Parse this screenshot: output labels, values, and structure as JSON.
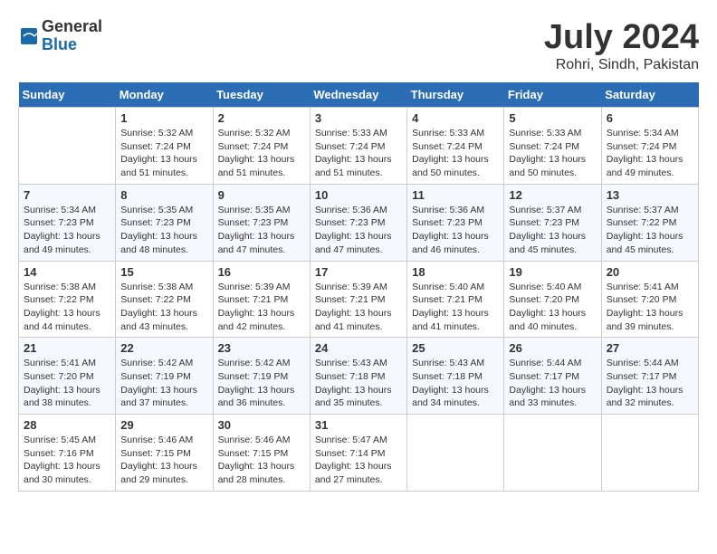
{
  "header": {
    "logo_general": "General",
    "logo_blue": "Blue",
    "month": "July 2024",
    "location": "Rohri, Sindh, Pakistan"
  },
  "weekdays": [
    "Sunday",
    "Monday",
    "Tuesday",
    "Wednesday",
    "Thursday",
    "Friday",
    "Saturday"
  ],
  "weeks": [
    [
      {
        "day": "",
        "info": ""
      },
      {
        "day": "1",
        "info": "Sunrise: 5:32 AM\nSunset: 7:24 PM\nDaylight: 13 hours\nand 51 minutes."
      },
      {
        "day": "2",
        "info": "Sunrise: 5:32 AM\nSunset: 7:24 PM\nDaylight: 13 hours\nand 51 minutes."
      },
      {
        "day": "3",
        "info": "Sunrise: 5:33 AM\nSunset: 7:24 PM\nDaylight: 13 hours\nand 51 minutes."
      },
      {
        "day": "4",
        "info": "Sunrise: 5:33 AM\nSunset: 7:24 PM\nDaylight: 13 hours\nand 50 minutes."
      },
      {
        "day": "5",
        "info": "Sunrise: 5:33 AM\nSunset: 7:24 PM\nDaylight: 13 hours\nand 50 minutes."
      },
      {
        "day": "6",
        "info": "Sunrise: 5:34 AM\nSunset: 7:24 PM\nDaylight: 13 hours\nand 49 minutes."
      }
    ],
    [
      {
        "day": "7",
        "info": "Sunrise: 5:34 AM\nSunset: 7:23 PM\nDaylight: 13 hours\nand 49 minutes."
      },
      {
        "day": "8",
        "info": "Sunrise: 5:35 AM\nSunset: 7:23 PM\nDaylight: 13 hours\nand 48 minutes."
      },
      {
        "day": "9",
        "info": "Sunrise: 5:35 AM\nSunset: 7:23 PM\nDaylight: 13 hours\nand 47 minutes."
      },
      {
        "day": "10",
        "info": "Sunrise: 5:36 AM\nSunset: 7:23 PM\nDaylight: 13 hours\nand 47 minutes."
      },
      {
        "day": "11",
        "info": "Sunrise: 5:36 AM\nSunset: 7:23 PM\nDaylight: 13 hours\nand 46 minutes."
      },
      {
        "day": "12",
        "info": "Sunrise: 5:37 AM\nSunset: 7:23 PM\nDaylight: 13 hours\nand 45 minutes."
      },
      {
        "day": "13",
        "info": "Sunrise: 5:37 AM\nSunset: 7:22 PM\nDaylight: 13 hours\nand 45 minutes."
      }
    ],
    [
      {
        "day": "14",
        "info": "Sunrise: 5:38 AM\nSunset: 7:22 PM\nDaylight: 13 hours\nand 44 minutes."
      },
      {
        "day": "15",
        "info": "Sunrise: 5:38 AM\nSunset: 7:22 PM\nDaylight: 13 hours\nand 43 minutes."
      },
      {
        "day": "16",
        "info": "Sunrise: 5:39 AM\nSunset: 7:21 PM\nDaylight: 13 hours\nand 42 minutes."
      },
      {
        "day": "17",
        "info": "Sunrise: 5:39 AM\nSunset: 7:21 PM\nDaylight: 13 hours\nand 41 minutes."
      },
      {
        "day": "18",
        "info": "Sunrise: 5:40 AM\nSunset: 7:21 PM\nDaylight: 13 hours\nand 41 minutes."
      },
      {
        "day": "19",
        "info": "Sunrise: 5:40 AM\nSunset: 7:20 PM\nDaylight: 13 hours\nand 40 minutes."
      },
      {
        "day": "20",
        "info": "Sunrise: 5:41 AM\nSunset: 7:20 PM\nDaylight: 13 hours\nand 39 minutes."
      }
    ],
    [
      {
        "day": "21",
        "info": "Sunrise: 5:41 AM\nSunset: 7:20 PM\nDaylight: 13 hours\nand 38 minutes."
      },
      {
        "day": "22",
        "info": "Sunrise: 5:42 AM\nSunset: 7:19 PM\nDaylight: 13 hours\nand 37 minutes."
      },
      {
        "day": "23",
        "info": "Sunrise: 5:42 AM\nSunset: 7:19 PM\nDaylight: 13 hours\nand 36 minutes."
      },
      {
        "day": "24",
        "info": "Sunrise: 5:43 AM\nSunset: 7:18 PM\nDaylight: 13 hours\nand 35 minutes."
      },
      {
        "day": "25",
        "info": "Sunrise: 5:43 AM\nSunset: 7:18 PM\nDaylight: 13 hours\nand 34 minutes."
      },
      {
        "day": "26",
        "info": "Sunrise: 5:44 AM\nSunset: 7:17 PM\nDaylight: 13 hours\nand 33 minutes."
      },
      {
        "day": "27",
        "info": "Sunrise: 5:44 AM\nSunset: 7:17 PM\nDaylight: 13 hours\nand 32 minutes."
      }
    ],
    [
      {
        "day": "28",
        "info": "Sunrise: 5:45 AM\nSunset: 7:16 PM\nDaylight: 13 hours\nand 30 minutes."
      },
      {
        "day": "29",
        "info": "Sunrise: 5:46 AM\nSunset: 7:15 PM\nDaylight: 13 hours\nand 29 minutes."
      },
      {
        "day": "30",
        "info": "Sunrise: 5:46 AM\nSunset: 7:15 PM\nDaylight: 13 hours\nand 28 minutes."
      },
      {
        "day": "31",
        "info": "Sunrise: 5:47 AM\nSunset: 7:14 PM\nDaylight: 13 hours\nand 27 minutes."
      },
      {
        "day": "",
        "info": ""
      },
      {
        "day": "",
        "info": ""
      },
      {
        "day": "",
        "info": ""
      }
    ]
  ]
}
